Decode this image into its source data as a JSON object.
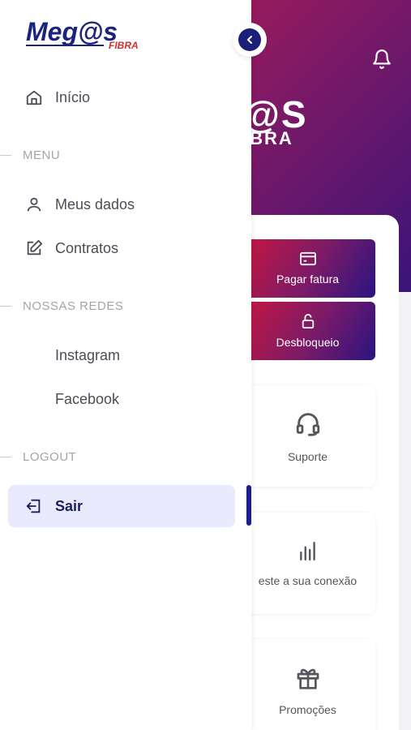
{
  "drawer": {
    "logo": {
      "text_main": "Meg@s",
      "text_sub": "FIBRA"
    },
    "home_label": "Início",
    "sections": {
      "menu": "MENU",
      "networks": "NOSSAS REDES",
      "logout": "LOGOUT"
    },
    "items": {
      "my_data": "Meus dados",
      "contracts": "Contratos",
      "instagram": "Instagram",
      "facebook": "Facebook",
      "sign_out": "Sair"
    }
  },
  "background": {
    "logo_main": "@S",
    "logo_sub": "IBRA",
    "actions": {
      "pay_invoice": "Pagar fatura",
      "unlock": "Desbloqueio"
    },
    "tiles": {
      "support": "Suporte",
      "speed_test": "este a sua conexão",
      "promotions": "Promoções"
    }
  },
  "colors": {
    "brand_navy": "#1a1f7a",
    "brand_red": "#c8173f",
    "active_bg": "#e9eafe"
  }
}
